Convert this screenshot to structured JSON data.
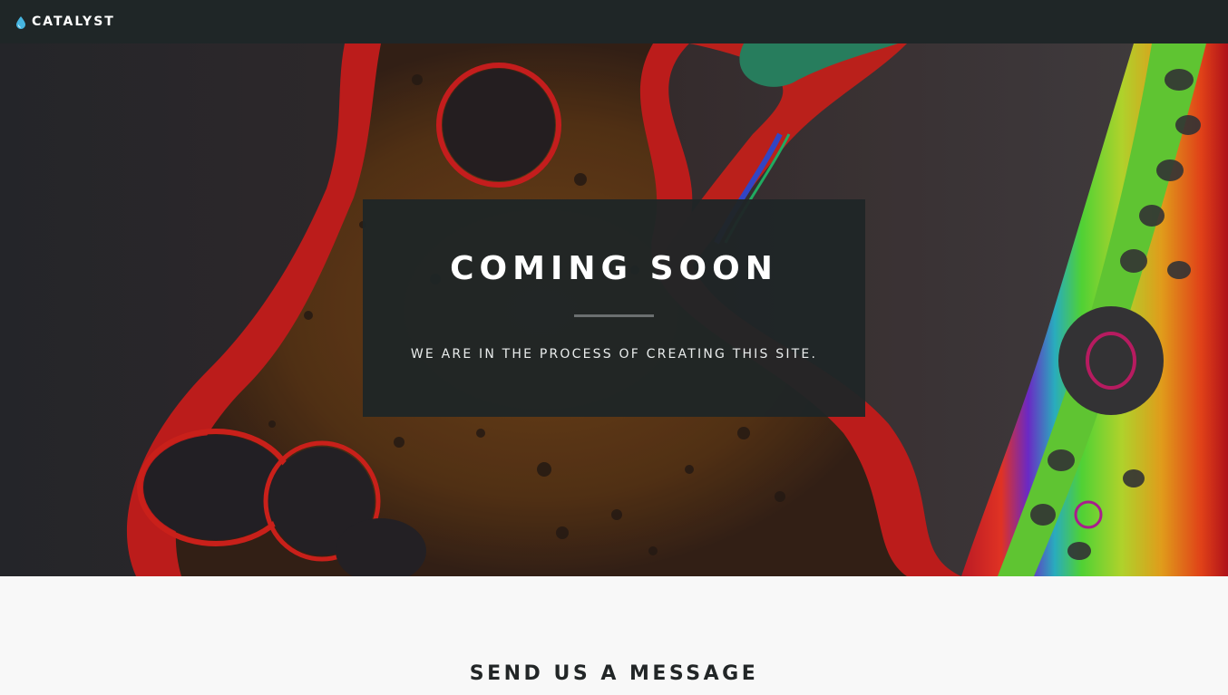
{
  "nav": {
    "brand": "CATALYST",
    "brand_icon": "water-drop-icon"
  },
  "hero": {
    "title": "COMING SOON",
    "subtitle": "WE ARE IN THE PROCESS OF CREATING THIS SITE."
  },
  "contact": {
    "title": "SEND US A MESSAGE"
  },
  "colors": {
    "nav_background": "#1f2627",
    "card_background": "#1f2526",
    "accent_drop": "#46b5e0",
    "section_background": "#f8f8f8"
  }
}
